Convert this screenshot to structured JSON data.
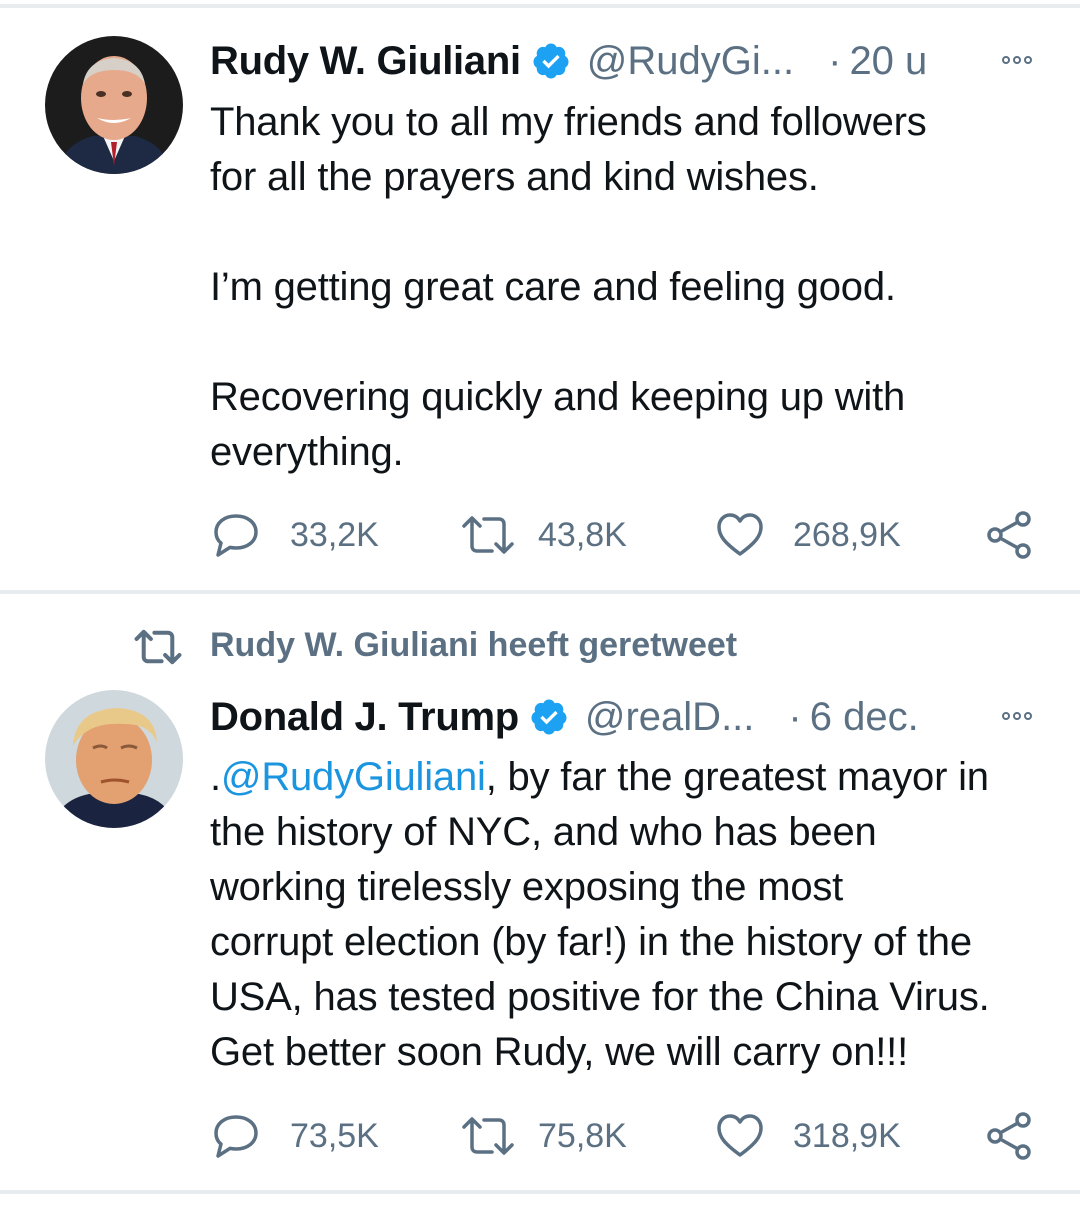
{
  "tweets": [
    {
      "author_name": "Rudy W. Giuliani",
      "handle": "@RudyGi...",
      "time": "20 u",
      "text": "Thank you to all my friends and followers\nfor all the prayers and kind wishes.\n\nI’m getting great care and feeling good.\n\nRecovering quickly and keeping up with\neverything.",
      "replies": "33,2K",
      "retweets": "43,8K",
      "likes": "268,9K"
    },
    {
      "retweet_label": "Rudy W. Giuliani heeft geretweet",
      "author_name": "Donald J. Trump",
      "handle": "@realD...",
      "time": "6 dec.",
      "mention": "@RudyGiuliani",
      "text_prefix": ".",
      "text_rest": ", by far the greatest mayor in\nthe history of NYC, and who has been\nworking tirelessly exposing the most\ncorrupt election (by far!) in the history of the\nUSA, has tested positive for the China Virus.\nGet better soon Rudy, we will carry on!!!",
      "replies": "73,5K",
      "retweets": "75,8K",
      "likes": "318,9K"
    }
  ],
  "separator_dot": "·",
  "colors": {
    "link": "#1b95e0",
    "secondary": "#5b7083",
    "verified": "#1da1f2",
    "divider": "#e8ecef"
  },
  "icons": [
    "verified-badge-icon",
    "more-icon",
    "reply-icon",
    "retweet-icon",
    "like-icon",
    "share-icon"
  ]
}
